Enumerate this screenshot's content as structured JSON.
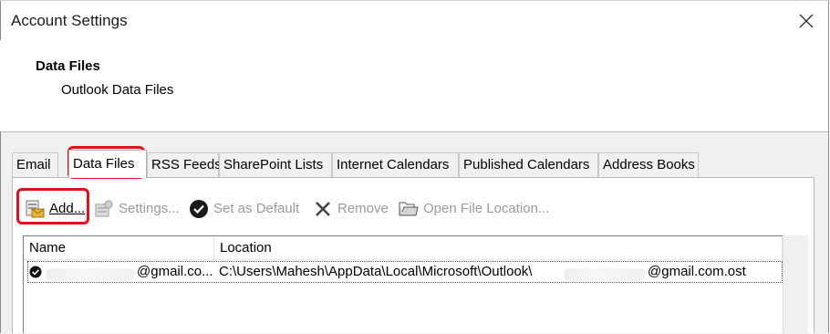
{
  "window": {
    "title": "Account Settings"
  },
  "header": {
    "title": "Data Files",
    "subtitle": "Outlook Data Files"
  },
  "tabs": [
    {
      "label": "Email"
    },
    {
      "label": "Data Files"
    },
    {
      "label": "RSS Feeds"
    },
    {
      "label": "SharePoint Lists"
    },
    {
      "label": "Internet Calendars"
    },
    {
      "label": "Published Calendars"
    },
    {
      "label": "Address Books"
    }
  ],
  "active_tab": "Data Files",
  "toolbar": {
    "add": "Add...",
    "settings": "Settings...",
    "set_default": "Set as Default",
    "remove": "Remove",
    "open_location": "Open File Location..."
  },
  "table": {
    "columns": [
      "Name",
      "Location"
    ],
    "rows": [
      {
        "name": "@gmail.co...",
        "location": "C:\\Users\\Mahesh\\AppData\\Local\\Microsoft\\Outlook\\",
        "location_suffix": "@gmail.com.ost",
        "is_default": true
      }
    ]
  },
  "colors": {
    "highlight": "#e0101e",
    "panel_bg": "#f0f0f0"
  },
  "icons": {
    "close": "close-icon",
    "add": "add-data-file-icon",
    "settings": "settings-icon",
    "set_default": "check-circle-icon",
    "remove": "remove-x-icon",
    "open_location": "folder-open-icon"
  }
}
